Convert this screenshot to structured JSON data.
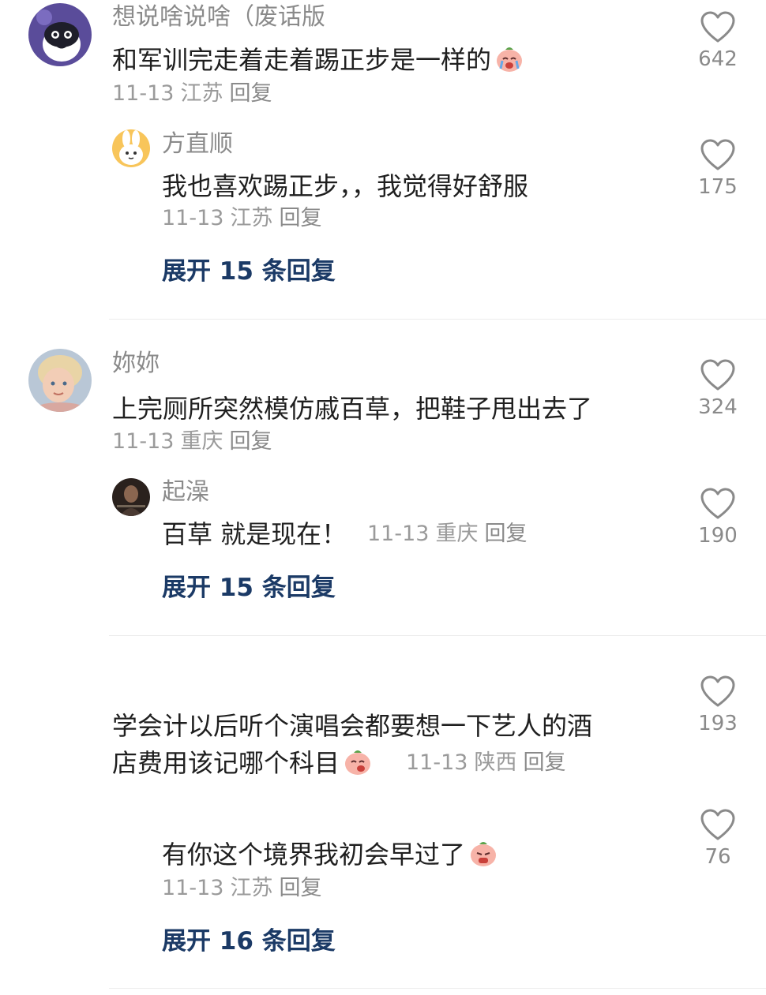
{
  "comments": [
    {
      "username": "想说啥说啥（废话版",
      "text": "和军训完走着走着踢正步是一样的",
      "date": "11-13",
      "location": "江苏",
      "reply_label": "回复",
      "likes": "642",
      "replies": [
        {
          "username": "方直顺",
          "text": "我也喜欢踢正步，，我觉得好舒服",
          "date": "11-13",
          "location": "江苏",
          "reply_label": "回复",
          "likes": "175"
        }
      ],
      "expand_label": "展开 15 条回复"
    },
    {
      "username": "妳妳",
      "text": "上完厕所突然模仿戚百草，把鞋子甩出去了",
      "date": "11-13",
      "location": "重庆",
      "reply_label": "回复",
      "likes": "324",
      "replies": [
        {
          "username": "起澡",
          "text": "百草 就是现在！",
          "date": "11-13",
          "location": "重庆",
          "reply_label": "回复",
          "likes": "190"
        }
      ],
      "expand_label": "展开 15 条回复"
    },
    {
      "username": "",
      "text_line1": "学会计以后听个演唱会都要想一下艺人的酒",
      "text_line2": "店费用该记哪个科目",
      "date": "11-13",
      "location": "陕西",
      "reply_label": "回复",
      "likes": "193",
      "replies": [
        {
          "username": "",
          "text": "有你这个境界我初会早过了",
          "date": "11-13",
          "location": "江苏",
          "reply_label": "回复",
          "likes": "76"
        }
      ],
      "expand_label": "展开 16 条回复"
    }
  ],
  "icons": {
    "like": "heart-outline-icon",
    "emoji": "crying-peach-emoji-icon"
  },
  "colors": {
    "expand": "#1b3a66",
    "meta": "#9a9a9a",
    "text": "#1f1f1f"
  }
}
